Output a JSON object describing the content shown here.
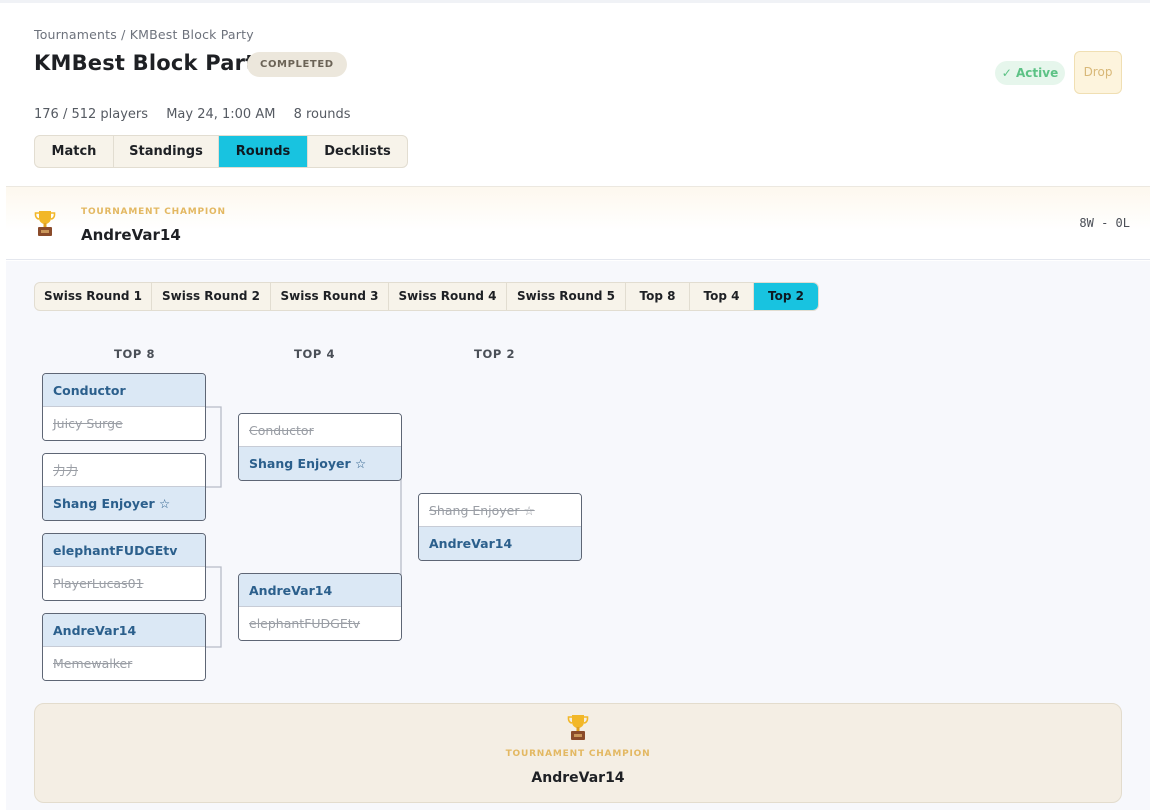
{
  "breadcrumb": "Tournaments / KMBest Block Party",
  "title": "KMBest Block Party",
  "status_badge": "COMPLETED",
  "active_label": "✓ Active",
  "drop_label": "Drop",
  "meta": {
    "players": "176 / 512 players",
    "date": "May 24, 1:00 AM",
    "rounds": "8 rounds"
  },
  "main_tabs": [
    "Match",
    "Standings",
    "Rounds",
    "Decklists"
  ],
  "main_tab_active": "Rounds",
  "champion_banner": {
    "label": "TOURNAMENT CHAMPION",
    "name": "AndreVar14",
    "record": "8W - 0L"
  },
  "round_tabs": [
    "Swiss Round 1",
    "Swiss Round 2",
    "Swiss Round 3",
    "Swiss Round 4",
    "Swiss Round 5",
    "Top 8",
    "Top 4",
    "Top 2"
  ],
  "round_tab_active": "Top 2",
  "bracket": {
    "columns": [
      "TOP 8",
      "TOP 4",
      "TOP 2"
    ],
    "top8": [
      {
        "p1": "Conductor",
        "p1_win": true,
        "p2": "Juicy Surge",
        "p2_win": false
      },
      {
        "p1": "力力",
        "p1_win": false,
        "p2": "Shang Enjoyer ☆",
        "p2_win": true
      },
      {
        "p1": "elephantFUDGEtv",
        "p1_win": true,
        "p2": "PlayerLucas01",
        "p2_win": false
      },
      {
        "p1": "AndreVar14",
        "p1_win": true,
        "p2": "Memewalker",
        "p2_win": false
      }
    ],
    "top4": [
      {
        "p1": "Conductor",
        "p1_win": false,
        "p2": "Shang Enjoyer ☆",
        "p2_win": true
      },
      {
        "p1": "AndreVar14",
        "p1_win": true,
        "p2": "elephantFUDGEtv",
        "p2_win": false
      }
    ],
    "top2": [
      {
        "p1": "Shang Enjoyer ☆",
        "p1_win": false,
        "p2": "AndreVar14",
        "p2_win": true
      }
    ]
  },
  "champion_card": {
    "label": "TOURNAMENT CHAMPION",
    "name": "AndreVar14",
    "icon": "trophy-icon"
  },
  "colors": {
    "accent": "#18c3e0",
    "winner_bg": "#dbe8f5",
    "winner_text": "#2b5f8c",
    "gold": "#e3b862"
  }
}
